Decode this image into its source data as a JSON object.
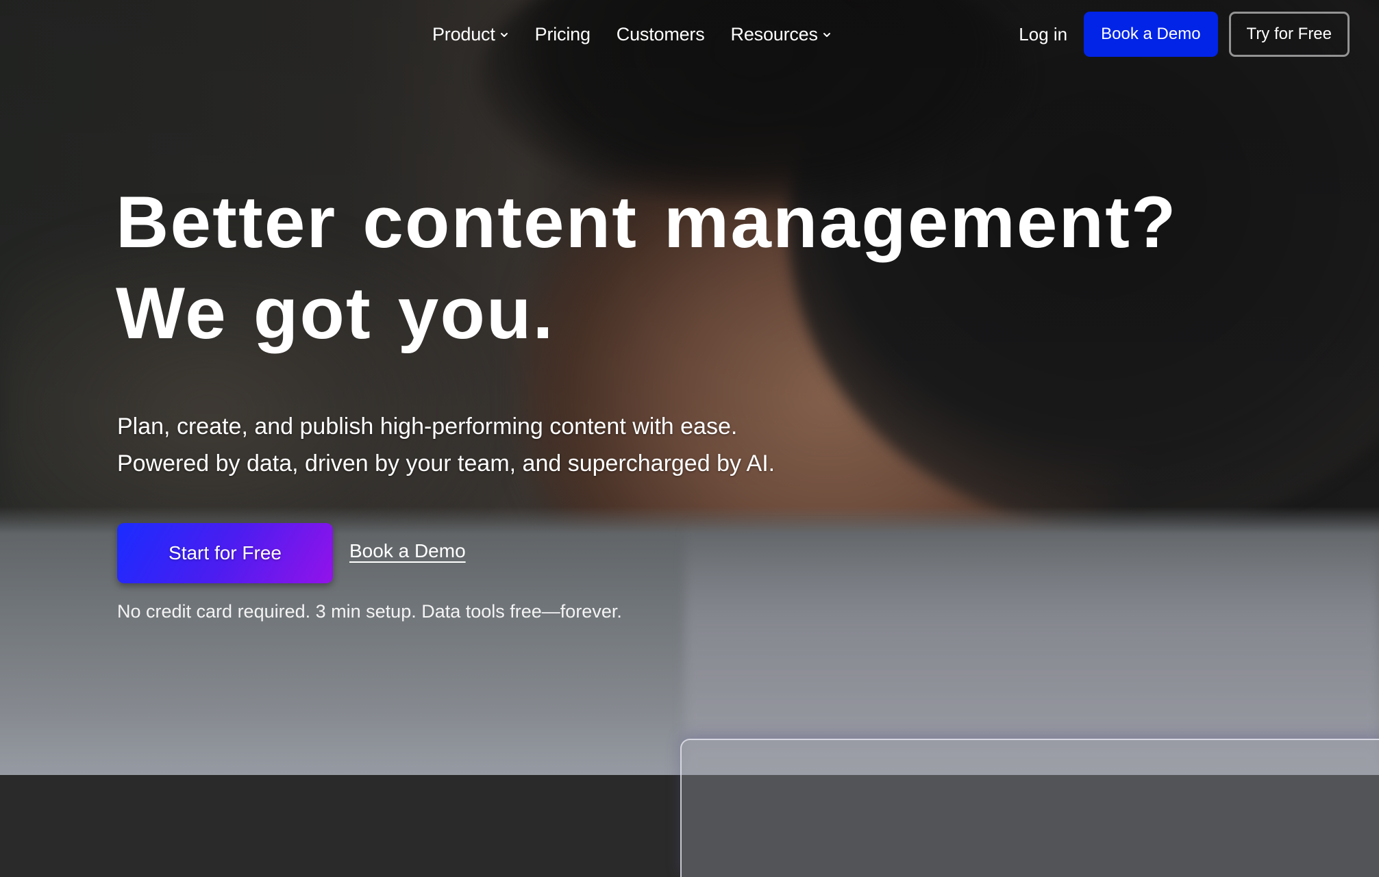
{
  "nav": {
    "links": [
      {
        "label": "Product",
        "has_dropdown": true
      },
      {
        "label": "Pricing",
        "has_dropdown": false
      },
      {
        "label": "Customers",
        "has_dropdown": false
      },
      {
        "label": "Resources",
        "has_dropdown": true
      }
    ],
    "login_label": "Log in",
    "book_demo_label": "Book a Demo",
    "try_free_label": "Try for Free",
    "dropdown_icon": "chevron-down-icon"
  },
  "hero": {
    "headline_line1": "Better content management?",
    "headline_line2": "We got you.",
    "subtitle_line1": "Plan, create, and publish high-performing content with ease.",
    "subtitle_line2": "Powered by data, driven by your team, and supercharged by AI.",
    "start_free_label": "Start for Free",
    "book_demo_link": "Book a Demo",
    "note": "No credit card required. 3 min setup. Data tools free—forever."
  },
  "colors": {
    "primary_button": "#0224e6",
    "cta_gradient_start": "#1a2cff",
    "cta_gradient_end": "#9313ea",
    "text": "#ffffff"
  }
}
